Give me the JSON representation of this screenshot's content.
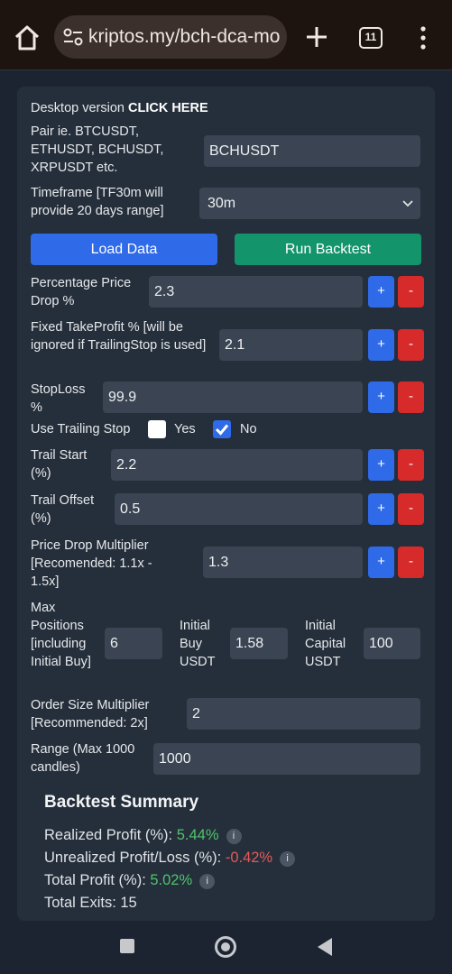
{
  "browser": {
    "url": "kriptos.my/bch-dca-mo",
    "tab_count": "11"
  },
  "desktop_link": {
    "prefix": "Desktop version ",
    "link": "CLICK HERE"
  },
  "pair": {
    "label": "Pair ie. BTCUSDT, ETHUSDT, BCHUSDT, XRPUSDT etc.",
    "value": "BCHUSDT"
  },
  "timeframe": {
    "label": "Timeframe [TF30m will provide 20 days range]",
    "value": "30m"
  },
  "buttons": {
    "load": "Load Data",
    "run": "Run Backtest"
  },
  "steppers": {
    "plus": "+",
    "minus": "-"
  },
  "price_drop": {
    "label": "Percentage Price Drop %",
    "value": "2.3"
  },
  "take_profit": {
    "label": "Fixed TakeProfit % [will be ignored if TrailingStop is used]",
    "value": "2.1"
  },
  "stop_loss": {
    "label": "StopLoss %",
    "value": "99.9"
  },
  "trailing": {
    "label": "Use Trailing Stop",
    "yes": "Yes",
    "no": "No",
    "yes_checked": false,
    "no_checked": true
  },
  "trail_start": {
    "label": "Trail Start (%)",
    "value": "2.2"
  },
  "trail_offset": {
    "label": "Trail Offset (%)",
    "value": "0.5"
  },
  "drop_multiplier": {
    "label": "Price Drop Multiplier [Recomended: 1.1x - 1.5x]",
    "value": "1.3"
  },
  "max_positions": {
    "label": "Max Positions [including Initial Buy]",
    "value": "6"
  },
  "initial_buy": {
    "label": "Initial Buy USDT",
    "value": "1.58"
  },
  "initial_capital": {
    "label": "Initial Capital USDT",
    "value": "100"
  },
  "order_multiplier": {
    "label": "Order Size Multiplier [Recommended: 2x]",
    "value": "2"
  },
  "range": {
    "label": "Range (Max 1000 candles)",
    "value": "1000"
  },
  "summary": {
    "title": "Backtest Summary",
    "realized_label": "Realized Profit (%): ",
    "realized_value": "5.44%",
    "unrealized_label": "Unrealized Profit/Loss (%): ",
    "unrealized_value": "-0.42%",
    "total_label": "Total Profit (%): ",
    "total_value": "5.02%",
    "exits_label": "Total Exits: ",
    "exits_value": "15",
    "info": "i"
  },
  "colors": {
    "accent_blue": "#2f6ae8",
    "green": "#14946a",
    "red": "#d72a2a",
    "profit": "#4fc36a",
    "loss": "#e35a5a"
  }
}
